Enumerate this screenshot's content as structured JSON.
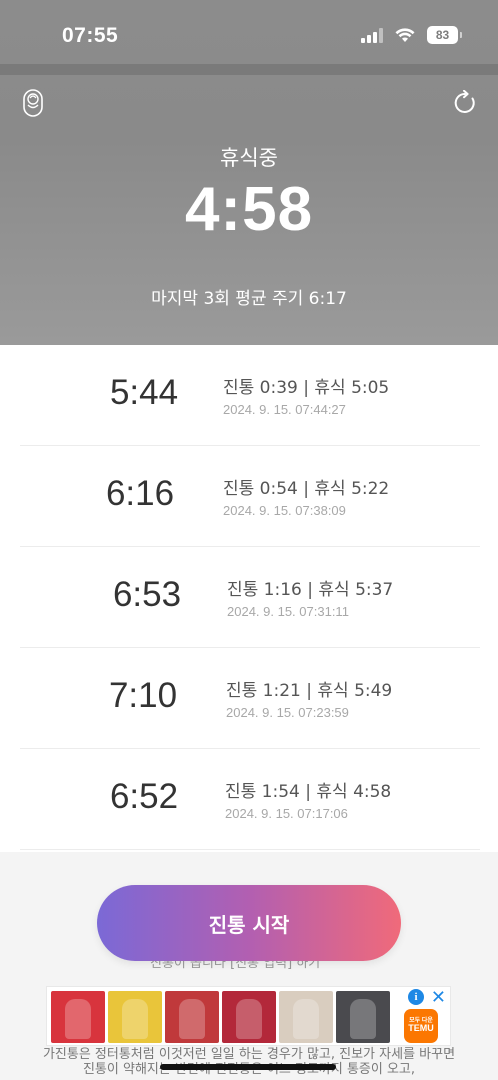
{
  "status": {
    "time": "07:55",
    "battery": "83"
  },
  "timer": {
    "state_label": "휴식중",
    "elapsed": "4:58",
    "average_label": "마지막 3회 평균 주기 6:17"
  },
  "records": [
    {
      "cycle": "5:44",
      "detail": "진통 0:39 | 휴식 5:05",
      "timestamp": "2024. 9. 15. 07:44:27"
    },
    {
      "cycle": "6:16",
      "detail": "진통 0:54 | 휴식 5:22",
      "timestamp": "2024. 9. 15. 07:38:09"
    },
    {
      "cycle": "6:53",
      "detail": "진통 1:16 | 휴식 5:37",
      "timestamp": "2024. 9. 15. 07:31:11"
    },
    {
      "cycle": "7:10",
      "detail": "진통 1:21 | 휴식 5:49",
      "timestamp": "2024. 9. 15. 07:23:59"
    },
    {
      "cycle": "6:52",
      "detail": "진통 1:54 | 휴식 4:58",
      "timestamp": "2024. 9. 15. 07:17:06"
    }
  ],
  "start_button": {
    "label": "진통 시작"
  },
  "behind_text": "진통이 옵니다 [진통 입력] 하기",
  "ad": {
    "brand": "TEMU",
    "brand_tag": "모두 다운",
    "info_glyph": "i",
    "close_glyph": "✕"
  },
  "under_text": [
    "가진통은 정터통처럼 이것저런 일일 하는 경우가 많고, 진보가 자세를 바꾸면",
    "진통이 약해지는 반면에 진진통은 어느 정도까지 통증이 오고,"
  ],
  "colors": {
    "header_bg": "#8c8c8c",
    "button_start": "#7b69d6",
    "button_end": "#f06a7a",
    "temu_orange": "#fb7701"
  }
}
